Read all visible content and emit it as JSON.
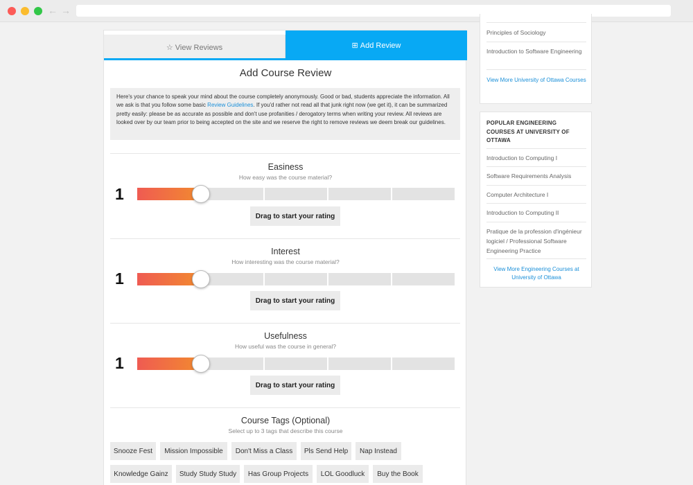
{
  "tabs": {
    "view_reviews": "View Reviews",
    "add_review": "Add Review",
    "view_icon": "star-outline-icon",
    "add_icon": "plus-square-icon"
  },
  "colors": {
    "accent": "#08a9f4",
    "gradient_start": "#ef5b52",
    "gradient_end": "#f28a2f",
    "link": "#1a8fd8"
  },
  "form": {
    "title": "Add Course Review",
    "intro_before_link": "Here's your chance to speak your mind about the course completely anonymously. Good or bad, students appreciate the information. All we ask is that you follow some basic ",
    "intro_link": "Review Guidelines",
    "intro_after_link": ". If you'd rather not read all that junk right now (we get it), it can be summarized pretty easily: please be as accurate as possible and don't use profanities / derogatory terms when writing your review. All reviews are looked over by our team prior to being accepted on the site and we reserve the right to remove reviews we deem break our guidelines."
  },
  "ratings": [
    {
      "title": "Easiness",
      "subtitle": "How easy was the course material?",
      "value": "1",
      "level": 0.2,
      "button": "Drag to start your rating"
    },
    {
      "title": "Interest",
      "subtitle": "How interesting was the course material?",
      "value": "1",
      "level": 0.2,
      "button": "Drag to start your rating"
    },
    {
      "title": "Usefulness",
      "subtitle": "How useful was the course in general?",
      "value": "1",
      "level": 0.2,
      "button": "Drag to start your rating"
    }
  ],
  "tags": {
    "title": "Course Tags (Optional)",
    "subtitle": "Select up to 3 tags that describe this course",
    "items": [
      "Snooze Fest",
      "Mission Impossible",
      "Don't Miss a Class",
      "Pls Send Help",
      "Nap Instead",
      "Knowledge Gainz",
      "Study Study Study",
      "Has Group Projects",
      "LOL Goodluck",
      "Buy the Book"
    ]
  },
  "sidebar_top": {
    "items": [
      "Principles of Sociology",
      "Introduction to Software Engineering"
    ],
    "link": "View More University of Ottawa Courses"
  },
  "sidebar_engineering": {
    "heading": "POPULAR ENGINEERING COURSES AT UNIVERSITY OF OTTAWA",
    "items": [
      "Introduction to Computing I",
      "Software Requirements Analysis",
      "Computer Architecture I",
      "Introduction to Computing II",
      "Pratique de la profession d'ingénieur logiciel / Professional Software Engineering Practice"
    ],
    "link": "View More Engineering Courses at University of Ottawa"
  }
}
